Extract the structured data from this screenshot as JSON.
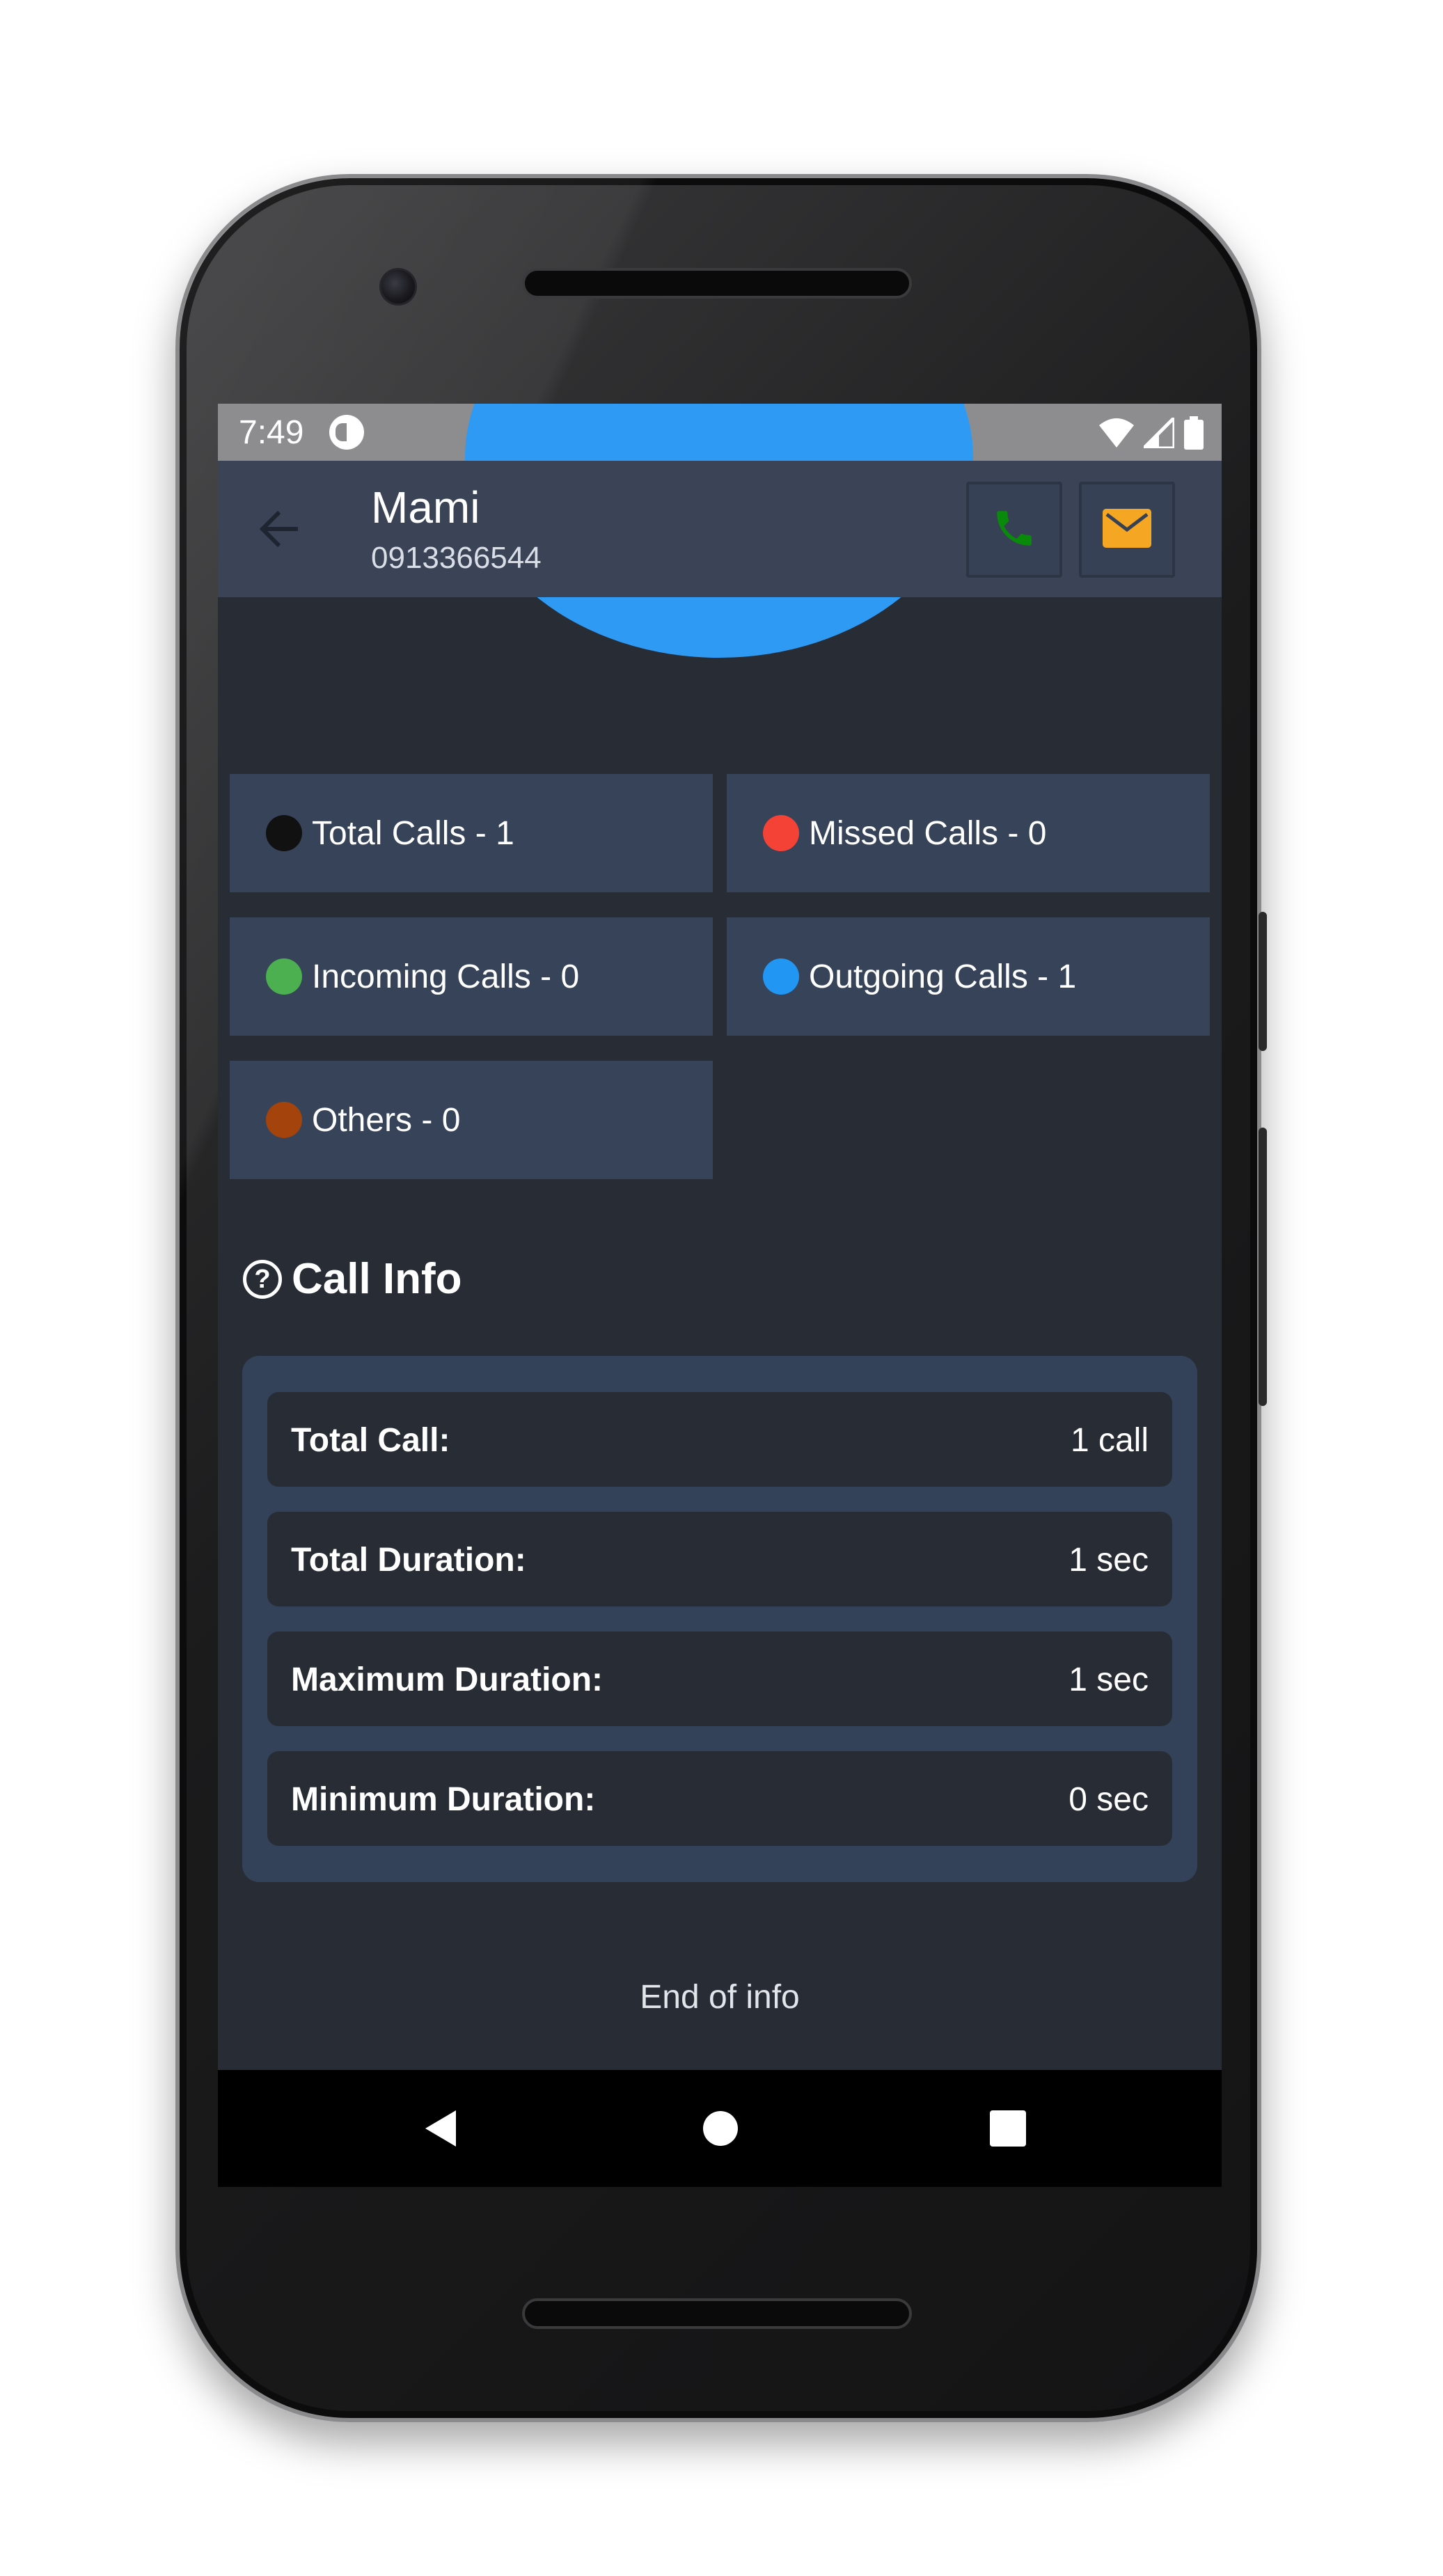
{
  "status_bar": {
    "time": "7:49",
    "icons": [
      "app-notification-icon",
      "wifi-icon",
      "signal-icon",
      "battery-icon"
    ]
  },
  "app_bar": {
    "contact_name": "Mami",
    "contact_number": "0913366544",
    "actions": [
      "phone-icon",
      "mail-icon"
    ],
    "colors": {
      "phone": "#0a8a0a",
      "mail": "#f5a623"
    }
  },
  "stats": [
    {
      "label": "Total Calls - 1",
      "color": "#111111"
    },
    {
      "label": "Missed Calls - 0",
      "color": "#f44336"
    },
    {
      "label": "Incoming Calls - 0",
      "color": "#4caf50"
    },
    {
      "label": "Outgoing Calls - 1",
      "color": "#2196f3"
    },
    {
      "label": "Others - 0",
      "color": "#a5430d"
    }
  ],
  "call_info": {
    "title": "Call Info",
    "rows": [
      {
        "label": "Total Call:",
        "value": "1 call"
      },
      {
        "label": "Total Duration:",
        "value": "1 sec"
      },
      {
        "label": "Maximum Duration:",
        "value": "1 sec"
      },
      {
        "label": "Minimum Duration:",
        "value": "0 sec"
      }
    ]
  },
  "footer": {
    "text": "End of info"
  },
  "nav_bar": {
    "buttons": [
      "back-icon",
      "home-icon",
      "recents-icon"
    ]
  }
}
